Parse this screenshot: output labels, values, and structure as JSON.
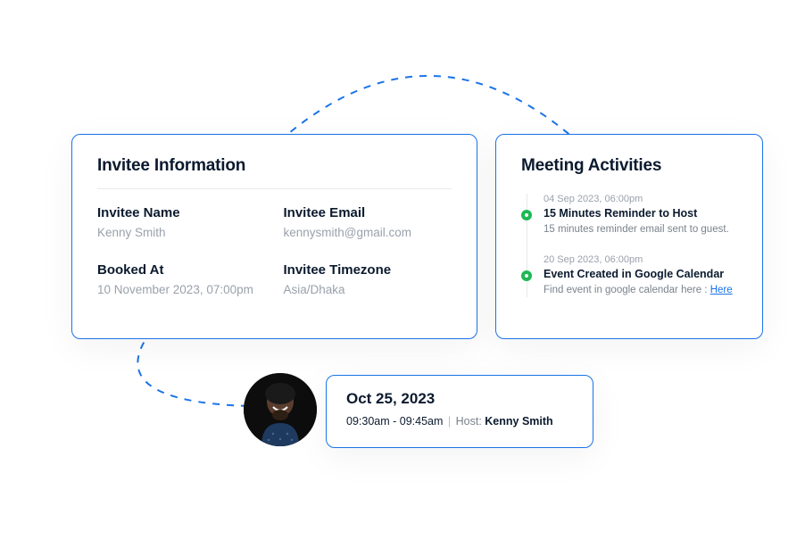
{
  "invitee": {
    "title": "Invitee Information",
    "fields": {
      "name": {
        "label": "Invitee Name",
        "value": "Kenny Smith"
      },
      "email": {
        "label": "Invitee Email",
        "value": "kennysmith@gmail.com"
      },
      "booked": {
        "label": "Booked At",
        "value": "10 November 2023, 07:00pm"
      },
      "timezone": {
        "label": "Invitee Timezone",
        "value": "Asia/Dhaka"
      }
    }
  },
  "activities": {
    "title": "Meeting Activities",
    "items": [
      {
        "timestamp": "04 Sep 2023, 06:00pm",
        "title": "15 Minutes Reminder to Host",
        "description": "15 minutes reminder email sent to guest.",
        "link_prefix": "",
        "link_label": ""
      },
      {
        "timestamp": "20 Sep 2023, 06:00pm",
        "title": "Event Created in Google Calendar",
        "description": "Find event in google calendar here : ",
        "link_label": "Here"
      }
    ]
  },
  "summary": {
    "date": "Oct 25, 2023",
    "time_range": "09:30am - 09:45am",
    "host_label": "Host: ",
    "host_name": "Kenny Smith"
  }
}
